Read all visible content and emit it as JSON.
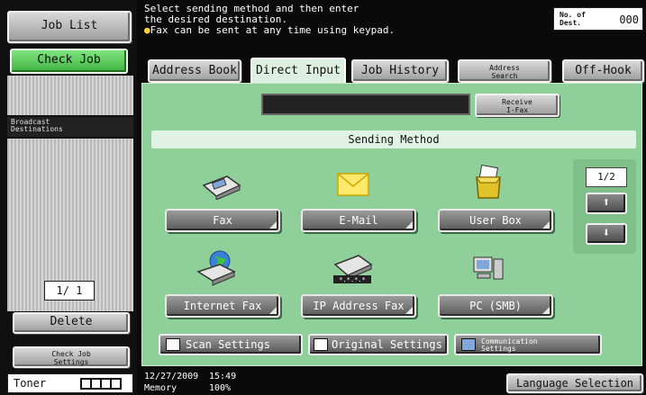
{
  "left": {
    "job_list": "Job List",
    "check_job": "Check Job",
    "broadcast": "Broadcast\nDestinations",
    "page_counter": "1/ 1",
    "delete": "Delete",
    "check_job_settings": "Check Job\nSettings",
    "toner_label": "Toner"
  },
  "header": {
    "message_line1": "Select sending method and then enter",
    "message_line2": "the desired destination.",
    "message_line3": "Fax can be sent at any time using keypad.",
    "dest_label": "No. of\nDest.",
    "dest_count": "000"
  },
  "tabs": [
    {
      "label": "Address Book"
    },
    {
      "label": "Direct Input"
    },
    {
      "label": "Job History"
    },
    {
      "label": "Address\nSearch"
    },
    {
      "label": "Off-Hook"
    }
  ],
  "receive_ifax": "Receive\nI-Fax",
  "sending_method": "Sending Method",
  "methods": [
    {
      "label": "Fax",
      "icon": "fax-icon"
    },
    {
      "label": "E-Mail",
      "icon": "envelope-icon"
    },
    {
      "label": "User Box",
      "icon": "user-box-icon"
    },
    {
      "label": "Internet Fax",
      "icon": "internet-fax-icon"
    },
    {
      "label": "IP Address Fax",
      "icon": "ip-fax-icon"
    },
    {
      "label": "PC (SMB)",
      "icon": "computer-icon"
    }
  ],
  "pager": {
    "page": "1/2"
  },
  "settings": {
    "scan": "Scan Settings",
    "original": "Original Settings",
    "communication": "Communication\nSettings"
  },
  "footer": {
    "date": "12/27/2009",
    "time": "15:49",
    "memory_label": "Memory",
    "memory_value": "100%",
    "language": "Language Selection"
  },
  "colors": {
    "panel": "#8fcf9a",
    "accent_green": "#3fb23f"
  }
}
